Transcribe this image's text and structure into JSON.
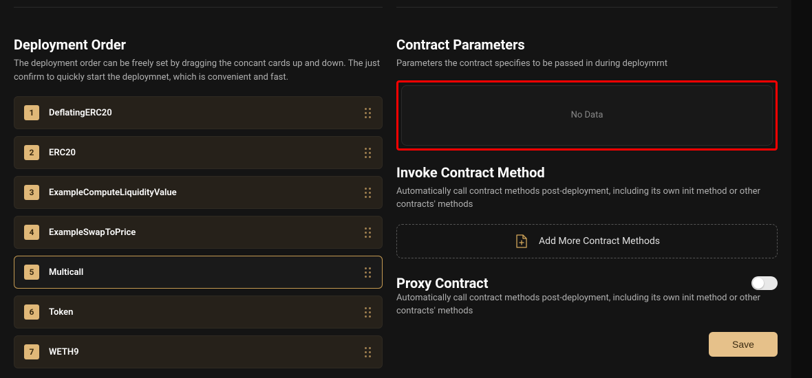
{
  "deployment_order": {
    "title": "Deployment Order",
    "desc": "The deployment order can be freely set by dragging the concant cards up and down. The just confirm to quickly start the deploymnet, which is convenient and fast.",
    "items": [
      {
        "num": "1",
        "name": "DeflatingERC20",
        "selected": false
      },
      {
        "num": "2",
        "name": "ERC20",
        "selected": false
      },
      {
        "num": "3",
        "name": "ExampleComputeLiquidityValue",
        "selected": false
      },
      {
        "num": "4",
        "name": "ExampleSwapToPrice",
        "selected": false
      },
      {
        "num": "5",
        "name": "Multicall",
        "selected": true
      },
      {
        "num": "6",
        "name": "Token",
        "selected": false
      },
      {
        "num": "7",
        "name": "WETH9",
        "selected": false
      }
    ]
  },
  "contract_params": {
    "title": "Contract Parameters",
    "desc": "Parameters the contract specifies to be passed in during deploymrnt",
    "empty": "No Data"
  },
  "invoke": {
    "title": "Invoke Contract Method",
    "desc": "Automatically call contract methods post-deployment, including its own init method or other contracts' methods",
    "add_label": "Add More Contract Methods"
  },
  "proxy": {
    "title": "Proxy Contract",
    "desc": "Automatically call contract methods post-deployment, including its own init method or other contracts' methods",
    "enabled": false
  },
  "save_label": "Save"
}
